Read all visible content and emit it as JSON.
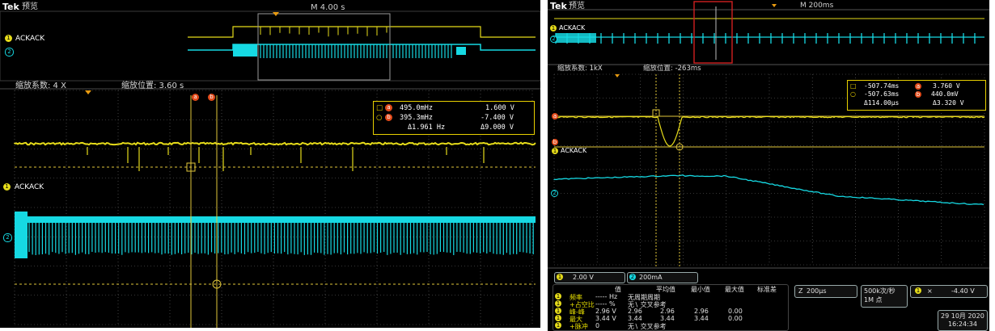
{
  "colors": {
    "ch1": "#e6dc1a",
    "ch2": "#16d9e3",
    "cursor": "#e0c63a",
    "grid": "#6b6b6b",
    "background": "#000000",
    "cursor_a": "#e24a1a"
  },
  "left": {
    "brand": "Tek",
    "mode": "预览",
    "timebase": "M 4.00 s",
    "zoom_factor": "缩放系数: 4 X",
    "zoom_position": "缩放位置: 3.60 s",
    "ch1_label": "ACKACK",
    "ch1_num": "1",
    "ch2_num": "2",
    "cursor_a": "a",
    "cursor_b": "b",
    "readout": {
      "a_val": "495.0mHz",
      "a_v": "1.600 V",
      "b_val": "395.3mHz",
      "b_v": "-7.400 V",
      "delta_val": "Δ1.961 Hz",
      "delta_v": "Δ9.000 V"
    }
  },
  "right": {
    "brand": "Tek",
    "mode": "预览",
    "timebase": "M 200ms",
    "zoom_factor": "缩放系数: 1kX",
    "zoom_position": "缩放位置: -263ms",
    "ch1_label": "ACKACK",
    "ch1_num": "1",
    "ch2_num": "2",
    "cursor_a": "a",
    "cursor_b": "b",
    "readout": {
      "a_val": "-507.74ms",
      "a_v": "3.760 V",
      "b_val": "-507.63ms",
      "b_v": "440.0mV",
      "delta_val": "Δ114.00μs",
      "delta_v": "Δ3.320 V"
    },
    "ch1_scale": "2.00 V",
    "ch2_scale": "200mA",
    "horiz_scale": "200μs",
    "sample_rate": "500k次/秒",
    "record_length": "1M 点",
    "trigger_channel": "1",
    "trigger_level": "-4.40 V",
    "date": "29 10月 2020",
    "time": "16:24:34",
    "meas_headers": [
      "值",
      "平均值",
      "最小值",
      "最大值",
      "标准差"
    ],
    "measurements": [
      {
        "ch": "1",
        "name": "频率",
        "value": "----- Hz",
        "mean": "无周期周期",
        "min": "",
        "max": "",
        "std": ""
      },
      {
        "ch": "1",
        "name": "+占空比",
        "value": "----- %",
        "mean": "无∖ 交叉参考",
        "min": "",
        "max": "",
        "std": ""
      },
      {
        "ch": "1",
        "name": "峰-峰",
        "value": "2.96 V",
        "mean": "2.96",
        "min": "2.96",
        "max": "2.96",
        "std": "0.00"
      },
      {
        "ch": "1",
        "name": "最大",
        "value": "3.44 V",
        "mean": "3.44",
        "min": "3.44",
        "max": "3.44",
        "std": "0.00"
      },
      {
        "ch": "1",
        "name": "+脉冲",
        "value": "0",
        "mean": "无∖ 交叉参考",
        "min": "",
        "max": "",
        "std": ""
      }
    ]
  }
}
